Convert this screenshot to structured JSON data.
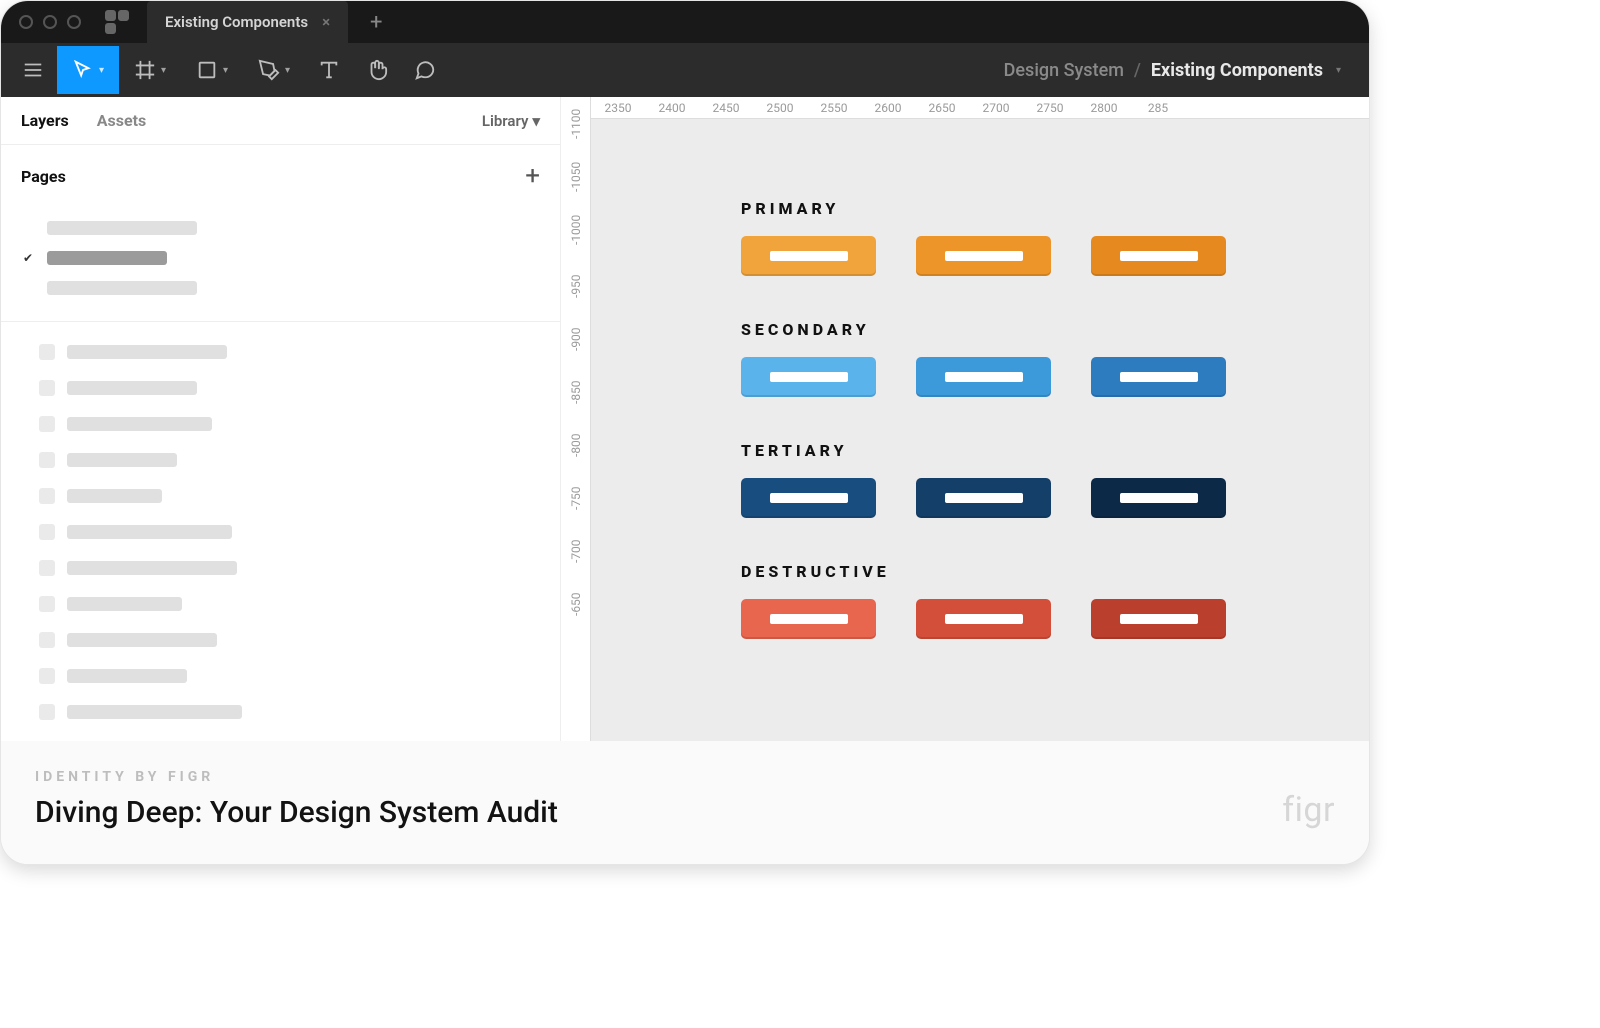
{
  "tab": {
    "label": "Existing Components"
  },
  "breadcrumb": {
    "project": "Design System",
    "page": "Existing Components"
  },
  "left_panel": {
    "tabs": {
      "layers": "Layers",
      "assets": "Assets",
      "library": "Library"
    },
    "pages_label": "Pages"
  },
  "rulers": {
    "horizontal": [
      "2350",
      "2400",
      "2450",
      "2500",
      "2550",
      "2600",
      "2650",
      "2700",
      "2750",
      "2800",
      "285"
    ],
    "vertical": [
      "-1100",
      "-1050",
      "-1000",
      "-950",
      "-900",
      "-850",
      "-800",
      "-750",
      "-700",
      "-650"
    ]
  },
  "component_groups": [
    {
      "label": "PRIMARY",
      "colors": [
        "#f1a33c",
        "#ed9528",
        "#e68a1f"
      ]
    },
    {
      "label": "SECONDARY",
      "colors": [
        "#5bb3ec",
        "#3c99da",
        "#2d7cc0"
      ]
    },
    {
      "label": "TERTIARY",
      "colors": [
        "#184d7f",
        "#143f69",
        "#0c2a47"
      ]
    },
    {
      "label": "DESTRUCTIVE",
      "colors": [
        "#e8654e",
        "#d44f3a",
        "#bb3f2d"
      ]
    }
  ],
  "caption": {
    "eyebrow": "IDENTITY BY FIGR",
    "title": "Diving Deep: Your Design System Audit",
    "brand": "figr"
  }
}
